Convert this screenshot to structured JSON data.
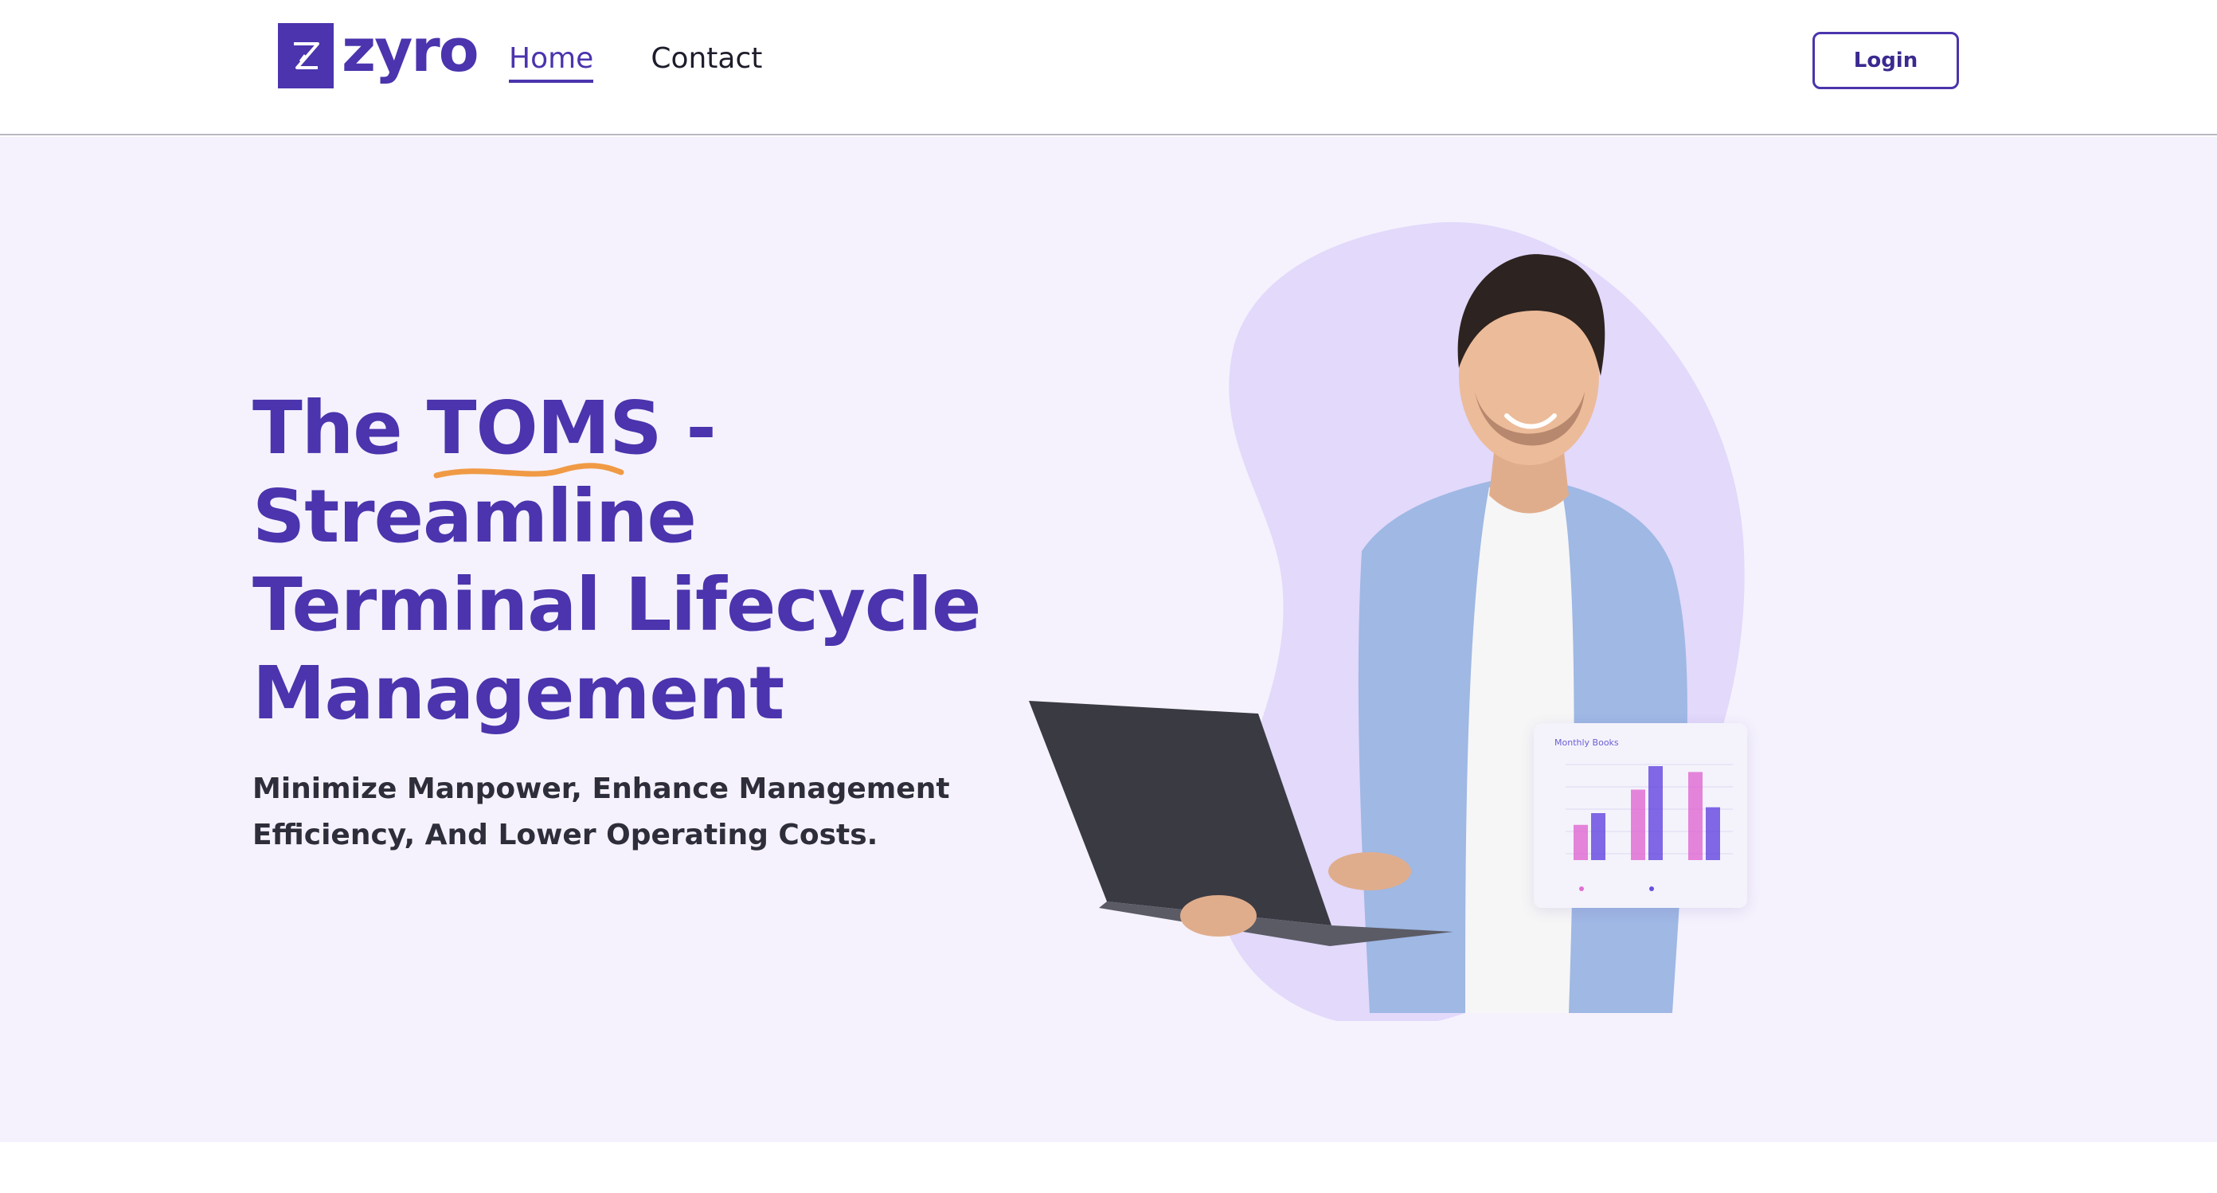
{
  "header": {
    "logo_text": "zyro",
    "nav": [
      {
        "label": "Home",
        "active": true
      },
      {
        "label": "Contact",
        "active": false
      }
    ],
    "login_label": "Login"
  },
  "hero": {
    "title_lines": [
      "The",
      "TOMS",
      "-",
      "Streamline",
      "Terminal Lifecycle",
      "Management"
    ],
    "subtitle_lines": [
      "Minimize Manpower, Enhance Management",
      "Efficiency, And Lower Operating Costs."
    ],
    "illustration_icon": "person-with-laptop-icon",
    "mini_chart_title": "Monthly Books"
  },
  "colors": {
    "brand": "#4b34ad",
    "hero_bg": "#f5f2fd",
    "blob": "#e2d9fb",
    "highlight": "#f09a45",
    "text_dark": "#2e2e3a"
  },
  "chart_data": {
    "type": "bar",
    "title": "Monthly Books",
    "categories": [
      "",
      "",
      ""
    ],
    "series": [
      {
        "values": [
          6,
          12,
          15
        ]
      },
      {
        "values": [
          8,
          16,
          9
        ]
      }
    ]
  }
}
